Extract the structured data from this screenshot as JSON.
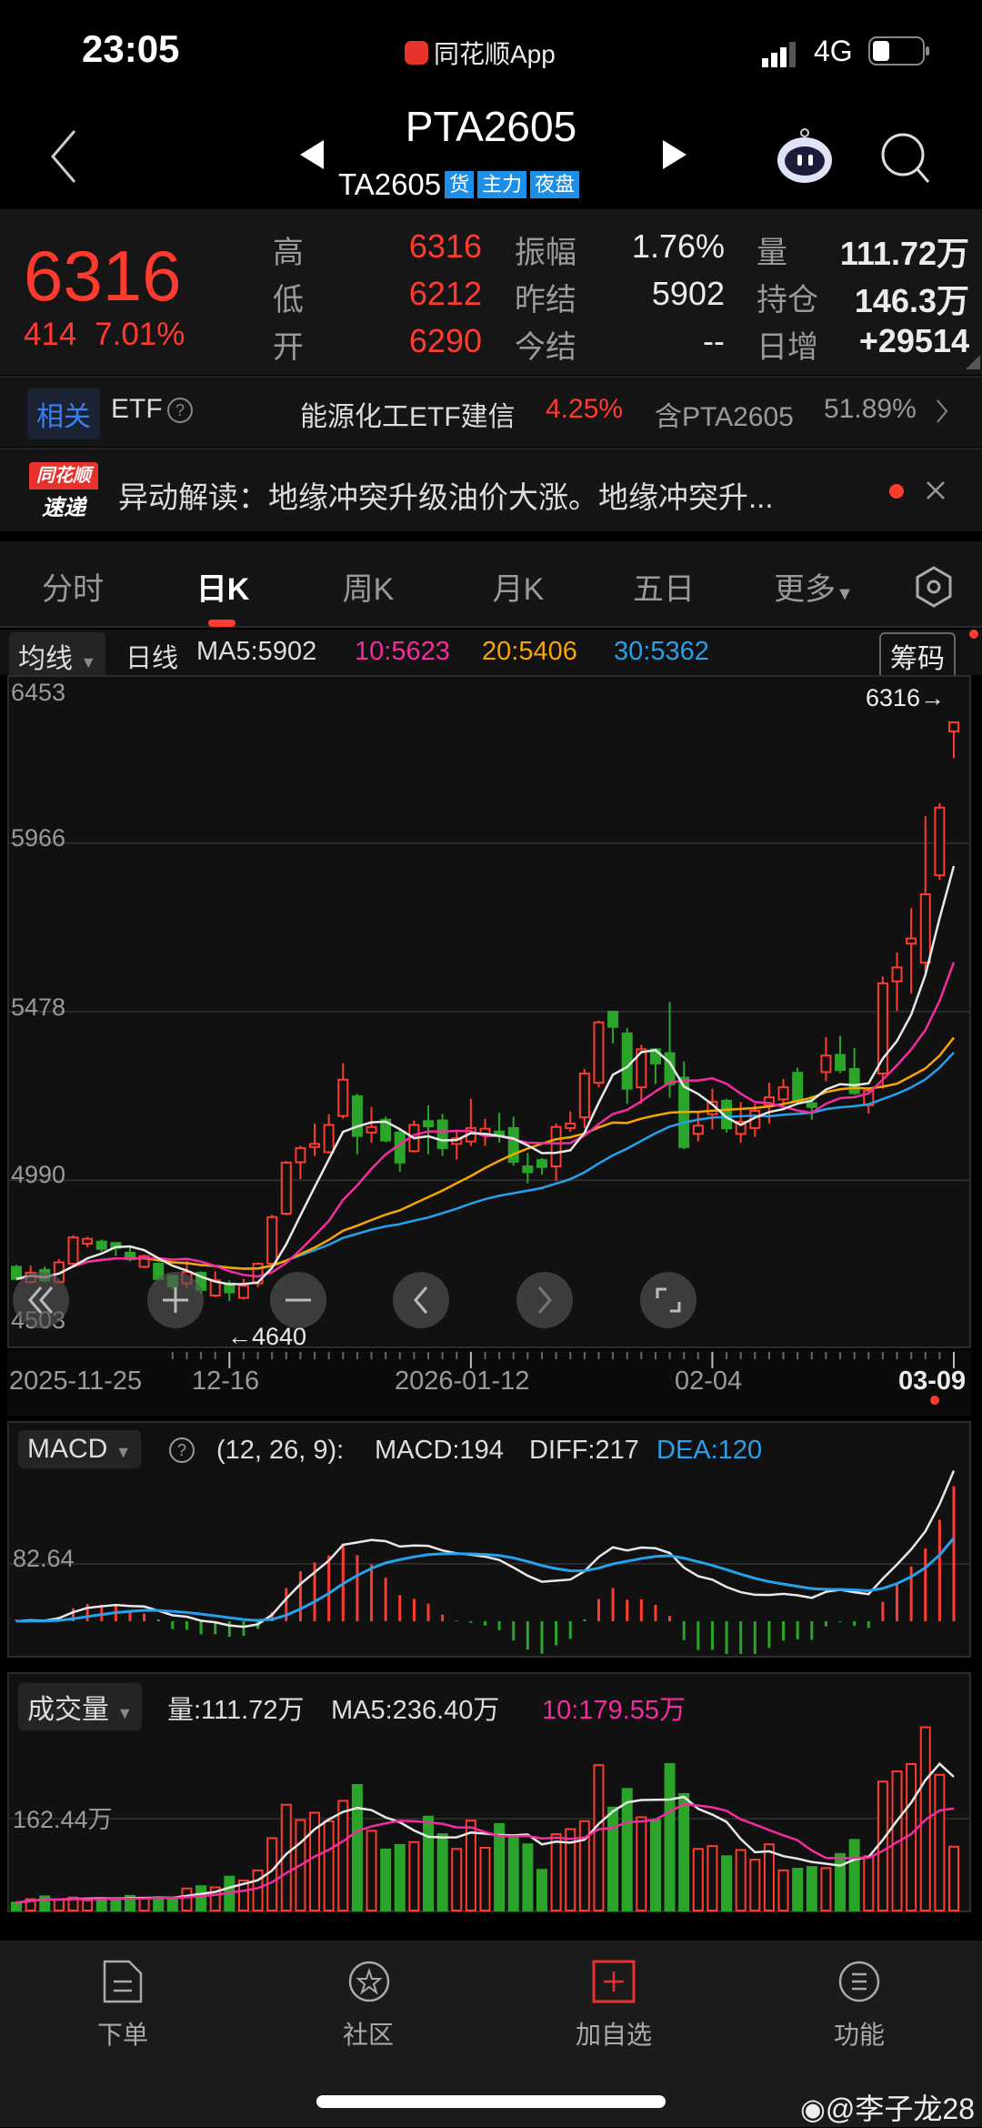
{
  "status": {
    "time": "23:05",
    "app": "同花顺App",
    "network": "4G"
  },
  "header": {
    "title": "PTA2605",
    "code": "TA2605",
    "badges": [
      "货",
      "主力",
      "夜盘"
    ]
  },
  "quote": {
    "price": "6316",
    "change": "414",
    "change_pct": "7.01%",
    "rows": [
      {
        "l1": "高",
        "v1": "6316",
        "l2": "振幅",
        "v2": "1.76%",
        "l3": "量",
        "v3": "111.72万"
      },
      {
        "l1": "低",
        "v1": "6212",
        "l2": "昨结",
        "v2": "5902",
        "l3": "持仓",
        "v3": "146.3万"
      },
      {
        "l1": "开",
        "v1": "6290",
        "l2": "今结",
        "v2": "--",
        "l3": "日增",
        "v3": "+29514"
      }
    ]
  },
  "etf": {
    "tag": "相关",
    "label": "ETF",
    "name": "能源化工ETF建信",
    "pct": "4.25%",
    "holding": "含PTA2605",
    "holding_pct": "51.89%"
  },
  "news": {
    "logo_top": "同花顺",
    "logo_bottom": "速递",
    "text": "异动解读：地缘冲突升级油价大涨。地缘冲突升..."
  },
  "tabs": [
    "分时",
    "日K",
    "周K",
    "月K",
    "五日",
    "更多"
  ],
  "ma_bar": {
    "selector": "均线",
    "period": "日线",
    "ma5": "MA5:5902",
    "ma10": "10:5623",
    "ma20": "20:5406",
    "ma30": "30:5362",
    "chips": "筹码"
  },
  "colors": {
    "up": "#ff3b2f",
    "down": "#2aa52a",
    "ma5": "#e8e8e8",
    "ma10": "#f52ca0",
    "ma20": "#f7a600",
    "ma30": "#24a2ee"
  },
  "main_chart": {
    "y_ticks": [
      "6453",
      "5966",
      "5478",
      "4990",
      "4503"
    ],
    "last_label": "6316→",
    "low_label": "←4640",
    "dates": [
      "2025-11-25",
      "12-16",
      "2026-01-12",
      "02-04",
      "03-09"
    ]
  },
  "macd": {
    "selector": "MACD",
    "params": "(12, 26, 9):",
    "macd": "MACD:194",
    "diff": "DIFF:217",
    "dea": "DEA:120",
    "grid_label": "82.64"
  },
  "volume": {
    "selector": "成交量",
    "vol": "量:111.72万",
    "ma5": "MA5:236.40万",
    "ma10": "10:179.55万",
    "grid_label": "162.44万"
  },
  "nav": [
    {
      "label": "下单"
    },
    {
      "label": "社区"
    },
    {
      "label": "加自选"
    },
    {
      "label": "功能"
    }
  ],
  "watermark": "@李子龙28",
  "chart_data": {
    "type": "candlestick",
    "title": "PTA2605 日K",
    "ylim": [
      4503,
      6453
    ],
    "x_tick_labels": [
      "2025-11-25",
      "12-16",
      "2026-01-12",
      "02-04",
      "03-09"
    ],
    "x_tick_index": [
      0,
      15,
      32,
      49,
      66
    ],
    "ohlc": [
      [
        4739,
        4745,
        4700,
        4704
      ],
      [
        4695,
        4743,
        4690,
        4722
      ],
      [
        4730,
        4740,
        4695,
        4700
      ],
      [
        4695,
        4761,
        4690,
        4752
      ],
      [
        4748,
        4830,
        4740,
        4824
      ],
      [
        4806,
        4826,
        4796,
        4820
      ],
      [
        4812,
        4818,
        4783,
        4791
      ],
      [
        4808,
        4810,
        4770,
        4794
      ],
      [
        4780,
        4795,
        4755,
        4761
      ],
      [
        4739,
        4774,
        4735,
        4770
      ],
      [
        4748,
        4752,
        4700,
        4704
      ],
      [
        4713,
        4718,
        4675,
        4682
      ],
      [
        4691,
        4756,
        4678,
        4724
      ],
      [
        4722,
        4726,
        4660,
        4672
      ],
      [
        4656,
        4726,
        4651,
        4700
      ],
      [
        4691,
        4700,
        4640,
        4665
      ],
      [
        4649,
        4704,
        4645,
        4684
      ],
      [
        4691,
        4752,
        4680,
        4748
      ],
      [
        4748,
        4890,
        4745,
        4883
      ],
      [
        4893,
        5045,
        4888,
        5041
      ],
      [
        5042,
        5090,
        4993,
        5083
      ],
      [
        5086,
        5154,
        5060,
        5095
      ],
      [
        5071,
        5181,
        5067,
        5150
      ],
      [
        5176,
        5329,
        5168,
        5281
      ],
      [
        5233,
        5240,
        5065,
        5118
      ],
      [
        5128,
        5202,
        5098,
        5144
      ],
      [
        5165,
        5174,
        5100,
        5105
      ],
      [
        5128,
        5135,
        5014,
        5041
      ],
      [
        5074,
        5163,
        5070,
        5150
      ],
      [
        5161,
        5207,
        5065,
        5146
      ],
      [
        5163,
        5182,
        5060,
        5083
      ],
      [
        5095,
        5133,
        5050,
        5111
      ],
      [
        5102,
        5226,
        5089,
        5141
      ],
      [
        5124,
        5168,
        5089,
        5139
      ],
      [
        5131,
        5185,
        5098,
        5118
      ],
      [
        5141,
        5174,
        5032,
        5043
      ],
      [
        5030,
        5069,
        4981,
        5013
      ],
      [
        5048,
        5054,
        5006,
        5028
      ],
      [
        5030,
        5154,
        4987,
        5144
      ],
      [
        5141,
        5189,
        5130,
        5154
      ],
      [
        5172,
        5312,
        5141,
        5299
      ],
      [
        5272,
        5452,
        5259,
        5447
      ],
      [
        5478,
        5478,
        5386,
        5434
      ],
      [
        5415,
        5430,
        5211,
        5255
      ],
      [
        5259,
        5382,
        5211,
        5369
      ],
      [
        5369,
        5372,
        5268,
        5328
      ],
      [
        5358,
        5506,
        5229,
        5268
      ],
      [
        5287,
        5334,
        5080,
        5086
      ],
      [
        5124,
        5185,
        5102,
        5148
      ],
      [
        5181,
        5255,
        5137,
        5217
      ],
      [
        5220,
        5226,
        5128,
        5140
      ],
      [
        5124,
        5216,
        5098,
        5159
      ],
      [
        5141,
        5211,
        5115,
        5191
      ],
      [
        5207,
        5272,
        5154,
        5230
      ],
      [
        5224,
        5283,
        5210,
        5259
      ],
      [
        5301,
        5316,
        5210,
        5220
      ],
      [
        5213,
        5235,
        5165,
        5202
      ],
      [
        5303,
        5404,
        5277,
        5351
      ],
      [
        5353,
        5408,
        5300,
        5309
      ],
      [
        5312,
        5373,
        5237,
        5242
      ],
      [
        5207,
        5259,
        5183,
        5249
      ],
      [
        5299,
        5580,
        5255,
        5560
      ],
      [
        5566,
        5649,
        5480,
        5606
      ],
      [
        5675,
        5778,
        5530,
        5690
      ],
      [
        5620,
        6045,
        5590,
        5818
      ],
      [
        5873,
        6082,
        5860,
        6069
      ],
      [
        6290,
        6316,
        6212,
        6316
      ]
    ],
    "volume_wan": [
      14,
      20,
      25,
      20,
      23,
      18,
      22,
      22,
      26,
      23,
      22,
      20,
      39,
      43,
      41,
      60,
      53,
      71,
      128,
      187,
      160,
      173,
      158,
      194,
      222,
      141,
      108,
      116,
      121,
      166,
      135,
      109,
      159,
      111,
      153,
      132,
      117,
      72,
      135,
      144,
      158,
      257,
      182,
      215,
      165,
      160,
      259,
      206,
      109,
      114,
      96,
      107,
      90,
      117,
      71,
      74,
      77,
      75,
      100,
      125,
      96,
      228,
      246,
      259,
      324,
      240,
      113
    ],
    "ma_periods": [
      5,
      10,
      20,
      30
    ],
    "macd_params": [
      12,
      26,
      9
    ],
    "volume_grid": 162.44,
    "macd_grid": 82.64
  }
}
